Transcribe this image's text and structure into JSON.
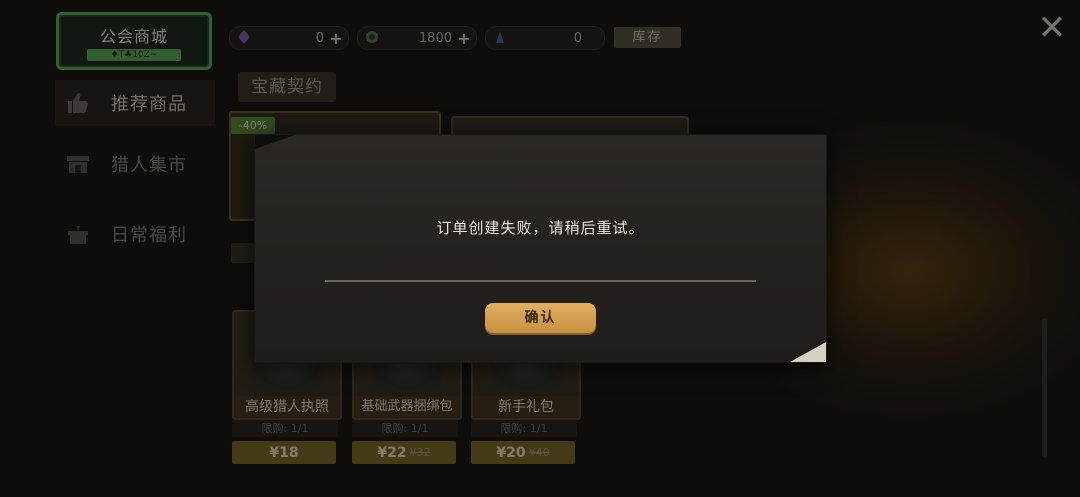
{
  "header": {
    "shop_title": "公会商城",
    "shop_subtitle": "♦T♣10Z~",
    "close_icon": "close-icon"
  },
  "resources": [
    {
      "icon": "purple-gem-icon",
      "value": "0"
    },
    {
      "icon": "coin-icon",
      "value": "1800"
    },
    {
      "icon": "blue-crystal-icon",
      "value": "0"
    }
  ],
  "stock_label": "库存",
  "sidebar": {
    "items": [
      {
        "label": "推荐商品",
        "icon": "thumbs-up-icon",
        "active": true
      },
      {
        "label": "猎人集市",
        "icon": "market-stall-icon",
        "active": false
      },
      {
        "label": "日常福利",
        "icon": "gift-box-icon",
        "active": false
      }
    ]
  },
  "section_tab": "宝藏契约",
  "featured": {
    "discount": "-40%"
  },
  "products": [
    {
      "name": "高级猎人执照",
      "limit": "限购: 1/1",
      "price": "¥18",
      "original_price": ""
    },
    {
      "name": "基础武器捆绑包",
      "limit": "限购: 1/1",
      "price": "¥22",
      "original_price": "¥32"
    },
    {
      "name": "新手礼包",
      "limit": "限购: 1/1",
      "price": "¥20",
      "original_price": "¥40"
    }
  ],
  "dialog": {
    "message": "订单创建失败，请稍后重试。",
    "confirm_label": "确认"
  },
  "colors": {
    "accent_gold": "#d9a656",
    "green_frame": "#5fa95a",
    "background": "#1b1815"
  }
}
